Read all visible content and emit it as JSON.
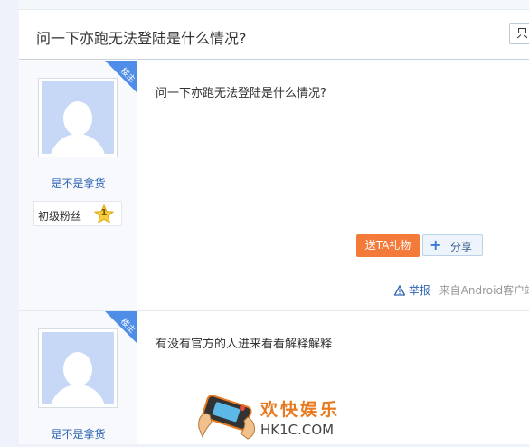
{
  "thread": {
    "title": "问一下亦跑无法登陆是什么情况?",
    "only_button": "只"
  },
  "posts": [
    {
      "badge": "楼主",
      "username": "是不是拿货",
      "level_name": "初级粉丝",
      "level_num": "1",
      "content": "问一下亦跑无法登陆是什么情况?",
      "gift_button": "送TA礼物",
      "share_button": "分享",
      "report_label": "举报",
      "source": "来自Android客户端"
    },
    {
      "badge": "楼主",
      "username": "是不是拿货",
      "content": "有没有官方的人进来看看解释解释"
    }
  ],
  "watermark": {
    "brand": "欢快娱乐",
    "domain": "HK1C.COM"
  },
  "colors": {
    "link": "#2d64b3",
    "badge": "#4f8ee8",
    "gift": "#f47a3a",
    "avatar": "#c7d8f7"
  }
}
